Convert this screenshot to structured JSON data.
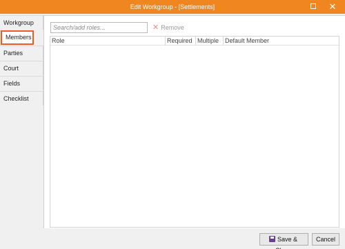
{
  "window": {
    "title": "Edit Workgroup - [Settlements]",
    "maximize_glyph": "",
    "close_glyph": "✕"
  },
  "sidebar": {
    "tabs": [
      {
        "label": "Workgroup"
      },
      {
        "label": "Members"
      },
      {
        "label": "Parties"
      },
      {
        "label": "Court"
      },
      {
        "label": "Fields"
      },
      {
        "label": "Checklist"
      }
    ],
    "active": "Members"
  },
  "toolbar": {
    "search_placeholder": "Search/add roles...",
    "remove_label": "Remove"
  },
  "grid": {
    "columns": [
      "Role",
      "Required",
      "Multiple",
      "Default Member"
    ],
    "rows": []
  },
  "footer": {
    "save_label": "Save & Close",
    "cancel_label": "Cancel"
  },
  "colors": {
    "titlebar": "#f0861f",
    "active_tab_border": "#f05a22",
    "save_icon": "#6b3f8e"
  }
}
